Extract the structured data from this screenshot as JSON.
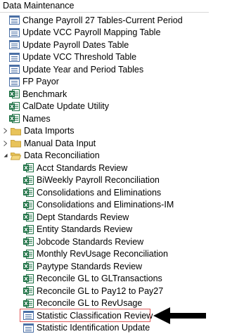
{
  "header": {
    "title": "Data Maintenance"
  },
  "tree": {
    "top_items": [
      {
        "icon": "form-icon",
        "label": "Change Payroll 27 Tables-Current Period"
      },
      {
        "icon": "form-icon",
        "label": "Update VCC Payroll Mapping Table"
      },
      {
        "icon": "form-icon",
        "label": "Update Payroll Dates Table"
      },
      {
        "icon": "form-icon",
        "label": "Update VCC Threshold Table"
      },
      {
        "icon": "form-icon",
        "label": "Update Year and Period Tables"
      },
      {
        "icon": "form-icon",
        "label": "FP Payor"
      },
      {
        "icon": "excel-icon",
        "label": "Benchmark"
      },
      {
        "icon": "excel-icon",
        "label": "CalDate Update Utility"
      },
      {
        "icon": "excel-icon",
        "label": "Names"
      }
    ],
    "folders": [
      {
        "label": "Data Imports",
        "expanded": false
      },
      {
        "label": "Manual Data Input",
        "expanded": false
      },
      {
        "label": "Data Reconciliation",
        "expanded": true
      }
    ],
    "reconciliation_items": [
      {
        "icon": "excel-icon",
        "label": "Acct Standards Review"
      },
      {
        "icon": "excel-icon",
        "label": "BiWeekly Payroll Reconciliation"
      },
      {
        "icon": "excel-icon",
        "label": "Consolidations and Eliminations"
      },
      {
        "icon": "excel-icon",
        "label": "Consolidations and Eliminations-IM"
      },
      {
        "icon": "excel-icon",
        "label": "Dept Standards Review"
      },
      {
        "icon": "excel-icon",
        "label": "Entity Standards Review"
      },
      {
        "icon": "excel-icon",
        "label": "Jobcode Standards Review"
      },
      {
        "icon": "excel-icon",
        "label": "Monthly RevUsage Reconciliation"
      },
      {
        "icon": "excel-icon",
        "label": "Paytype Standards Review"
      },
      {
        "icon": "excel-icon",
        "label": "Reconcile GL to GLTransactions"
      },
      {
        "icon": "excel-icon",
        "label": "Reconcile GL to Pay12 to Pay27"
      },
      {
        "icon": "excel-icon",
        "label": "Reconcile GL to RevUsage"
      },
      {
        "icon": "form-icon",
        "label": "Statistic Classification Review",
        "highlighted": true
      },
      {
        "icon": "form-icon",
        "label": "Statistic Identification Update"
      }
    ]
  },
  "colors": {
    "highlight": "#e05a5a",
    "excel_green": "#1e7145",
    "folder_yellow": "#e8c35a"
  }
}
